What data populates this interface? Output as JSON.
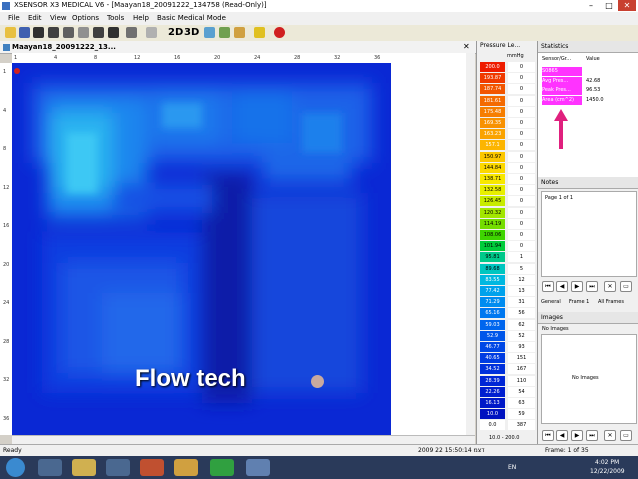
{
  "window": {
    "title": "XSENSOR X3 MEDICAL V6 - [Maayan18_20091222_134758 (Read-Only)]",
    "minimize": "–",
    "maximize": "□",
    "close": "✕"
  },
  "menu": [
    "File",
    "Edit",
    "View",
    "Options",
    "Tools",
    "Help",
    "Basic Medical Mode"
  ],
  "toolbar": {
    "view2d": "2D",
    "view3d": "3D"
  },
  "document": {
    "tab_label": "Maayan18_20091222_13...",
    "ruler_top": [
      "1",
      "4",
      "8",
      "12",
      "16",
      "20",
      "24",
      "28",
      "32",
      "36"
    ],
    "ruler_left": [
      "1",
      "4",
      "8",
      "12",
      "16",
      "20",
      "24",
      "28",
      "32",
      "36"
    ]
  },
  "legend": {
    "title": "Pressure Le...",
    "unit": "mmHg",
    "rows": [
      {
        "value": "200.0",
        "count": "0",
        "color": "#ee1c00"
      },
      {
        "value": "193.87",
        "count": "0",
        "color": "#f03a00"
      },
      {
        "value": "187.74",
        "count": "0",
        "color": "#f25500"
      },
      {
        "value": "181.61",
        "count": "0",
        "color": "#f46a00"
      },
      {
        "value": "175.48",
        "count": "0",
        "color": "#f67e00"
      },
      {
        "value": "169.35",
        "count": "0",
        "color": "#f89100"
      },
      {
        "value": "163.23",
        "count": "0",
        "color": "#faa300"
      },
      {
        "value": "157.1",
        "count": "0",
        "color": "#fcb500"
      },
      {
        "value": "150.97",
        "count": "0",
        "color": "#fcc700"
      },
      {
        "value": "144.84",
        "count": "0",
        "color": "#fcd800"
      },
      {
        "value": "138.71",
        "count": "0",
        "color": "#f8e800"
      },
      {
        "value": "132.58",
        "count": "0",
        "color": "#e8ef00"
      },
      {
        "value": "126.45",
        "count": "0",
        "color": "#c8ec00"
      },
      {
        "value": "120.32",
        "count": "0",
        "color": "#a2e600"
      },
      {
        "value": "114.19",
        "count": "0",
        "color": "#74dd00"
      },
      {
        "value": "108.06",
        "count": "0",
        "color": "#3ed400"
      },
      {
        "value": "101.94",
        "count": "0",
        "color": "#00cc3a"
      },
      {
        "value": "95.81",
        "count": "1",
        "color": "#00c98a"
      },
      {
        "value": "89.68",
        "count": "5",
        "color": "#00c6c0"
      },
      {
        "value": "83.55",
        "count": "12",
        "color": "#00b8e0"
      },
      {
        "value": "77.42",
        "count": "13",
        "color": "#00a2ec"
      },
      {
        "value": "71.29",
        "count": "31",
        "color": "#008cf0"
      },
      {
        "value": "65.16",
        "count": "56",
        "color": "#0078f0"
      },
      {
        "value": "59.03",
        "count": "62",
        "color": "#0066ee"
      },
      {
        "value": "52.9",
        "count": "52",
        "color": "#0056ea"
      },
      {
        "value": "46.77",
        "count": "93",
        "color": "#0048e6"
      },
      {
        "value": "40.65",
        "count": "151",
        "color": "#003ce2"
      },
      {
        "value": "34.52",
        "count": "167",
        "color": "#0030dc"
      },
      {
        "value": "28.39",
        "count": "110",
        "color": "#0026d6"
      },
      {
        "value": "22.26",
        "count": "54",
        "color": "#001ed0"
      },
      {
        "value": "16.13",
        "count": "63",
        "color": "#0018c8"
      },
      {
        "value": "10.0",
        "count": "59",
        "color": "#0012c0"
      },
      {
        "value": "0.0",
        "count": "387",
        "color": "#ffffff"
      }
    ],
    "range": "10.0 - 200.0"
  },
  "statistics": {
    "title": "Statistics",
    "col_sensor": "Sensor/Gr...",
    "col_value": "Value",
    "rows": [
      {
        "label": "S0865",
        "value": ""
      },
      {
        "label": "Avg Pres...",
        "value": "42.68"
      },
      {
        "label": "Peak Pres...",
        "value": "96.53"
      },
      {
        "label": "Area (cm^2)",
        "value": "1450.0"
      }
    ],
    "highlight": "#ff33ff",
    "arrow_color": "#e0207e"
  },
  "notes": {
    "title": "Notes",
    "page": "Page 1 of 1",
    "tabs": [
      "General",
      "Frame 1",
      "All Frames"
    ]
  },
  "images": {
    "title": "Images",
    "header": "No Images",
    "body": "No Images"
  },
  "status": {
    "left": "Ready",
    "datetime": "2009 22 דצמ 15:50:14",
    "frame": "Frame: 1 of 35"
  },
  "taskbar": {
    "lang": "EN",
    "time": "4:02 PM",
    "date": "12/22/2009"
  },
  "overlay": {
    "text": "Flow tech"
  }
}
